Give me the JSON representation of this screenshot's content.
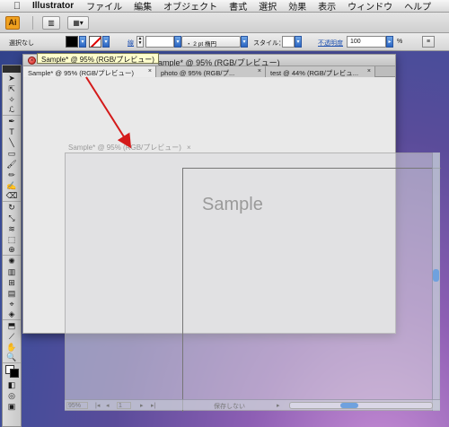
{
  "menubar": {
    "app_name": "Illustrator",
    "items": [
      "ファイル",
      "編集",
      "オブジェクト",
      "書式",
      "選択",
      "効果",
      "表示",
      "ウィンドウ",
      "ヘルプ"
    ]
  },
  "appbar": {
    "logo": "Ai",
    "buttons": [
      "bridge-icon",
      "arrange-documents-icon"
    ]
  },
  "control_panel": {
    "selection": "選択なし",
    "stroke_label": "線",
    "profile": "・ 2 pt 楕円",
    "style_label": "スタイル：",
    "opacity_label": "不透明度",
    "opacity_value": "100",
    "percent": "%"
  },
  "tooltip": "Sample* @ 95% (RGB/プレビュー)",
  "document": {
    "title": "ample* @ 95% (RGB/プレビュー)",
    "tabs": [
      {
        "label": "Sample* @ 95% (RGB/プレビュー)",
        "active": true
      },
      {
        "label": "photo @ 95% (RGB/プ...",
        "active": false
      },
      {
        "label": "test @ 44% (RGB/プレビュ...",
        "active": false
      }
    ],
    "tab_close": "×"
  },
  "ghost": {
    "title": "Sample* @ 95% (RGB/プレビュー)",
    "close": "×",
    "artboard_text": "Sample",
    "zoom": "95%",
    "page": "1",
    "save_status": "保存しない"
  },
  "colors": {
    "accent_blue": "#2a66c3",
    "arrow_red": "#d41a1a",
    "tooltip_bg": "#fffecc"
  }
}
